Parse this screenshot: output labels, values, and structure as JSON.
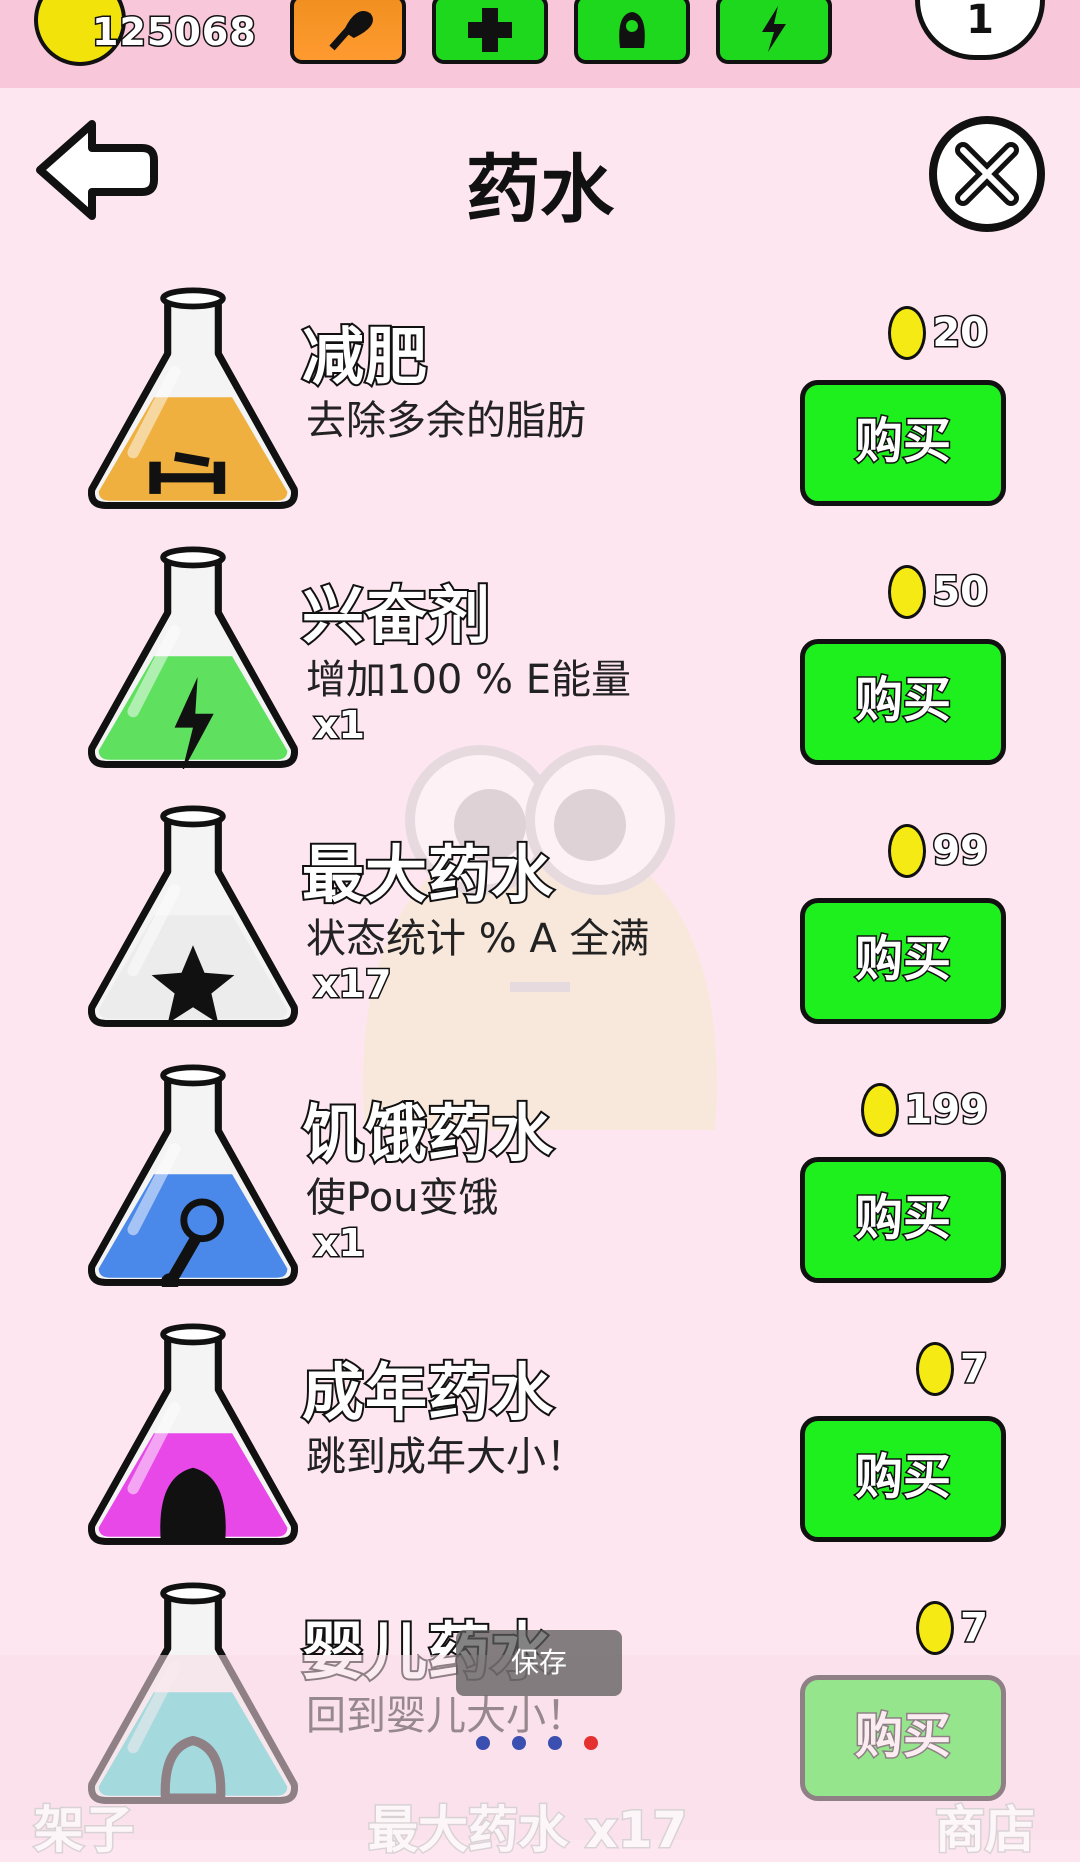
{
  "header": {
    "coins": "125068",
    "level": "1",
    "toolbar": [
      {
        "icon": "drumstick-icon",
        "color": "#f09020"
      },
      {
        "icon": "plus-cross-icon",
        "color": "#1ed81e"
      },
      {
        "icon": "pou-shape-icon",
        "color": "#1ed81e"
      },
      {
        "icon": "lightning-icon",
        "color": "#1ed81e"
      }
    ]
  },
  "page": {
    "title": "药水",
    "back_icon": "back-arrow-icon",
    "close_icon": "close-icon"
  },
  "items": [
    {
      "name": "减肥",
      "desc": "去除多余的脂肪",
      "qty": "",
      "price": "20",
      "buy": "购买",
      "liquid": "#f0b040",
      "symbol": "dumbbell-icon"
    },
    {
      "name": "兴奋剂",
      "desc": "增加100 % E能量",
      "qty": "x1",
      "price": "50",
      "buy": "购买",
      "liquid": "#5fe05f",
      "symbol": "lightning-icon"
    },
    {
      "name": "最大药水",
      "desc": "状态统计 % A 全满",
      "qty": "x17",
      "price": "99",
      "buy": "购买",
      "liquid": "#ececec",
      "symbol": "star-icon"
    },
    {
      "name": "饥饿药水",
      "desc": "使Pou变饿",
      "qty": "x1",
      "price": "199",
      "buy": "购买",
      "liquid": "#4a88ea",
      "symbol": "drumstick-icon"
    },
    {
      "name": "成年药水",
      "desc": "跳到成年大小！",
      "qty": "",
      "price": "7",
      "buy": "购买",
      "liquid": "#e848e8",
      "symbol": "pou-blob-icon"
    },
    {
      "name": "婴儿药水",
      "desc": "回到婴儿大小！",
      "qty": "",
      "price": "7",
      "buy": "购买",
      "liquid": "#3ed6d0",
      "symbol": "small-pou-icon"
    }
  ],
  "footer": {
    "left_label": "架子",
    "center_label": "最大药水 x17",
    "right_label": "商店",
    "toast": "保存",
    "page_dots": 4,
    "active_dot": 4
  }
}
